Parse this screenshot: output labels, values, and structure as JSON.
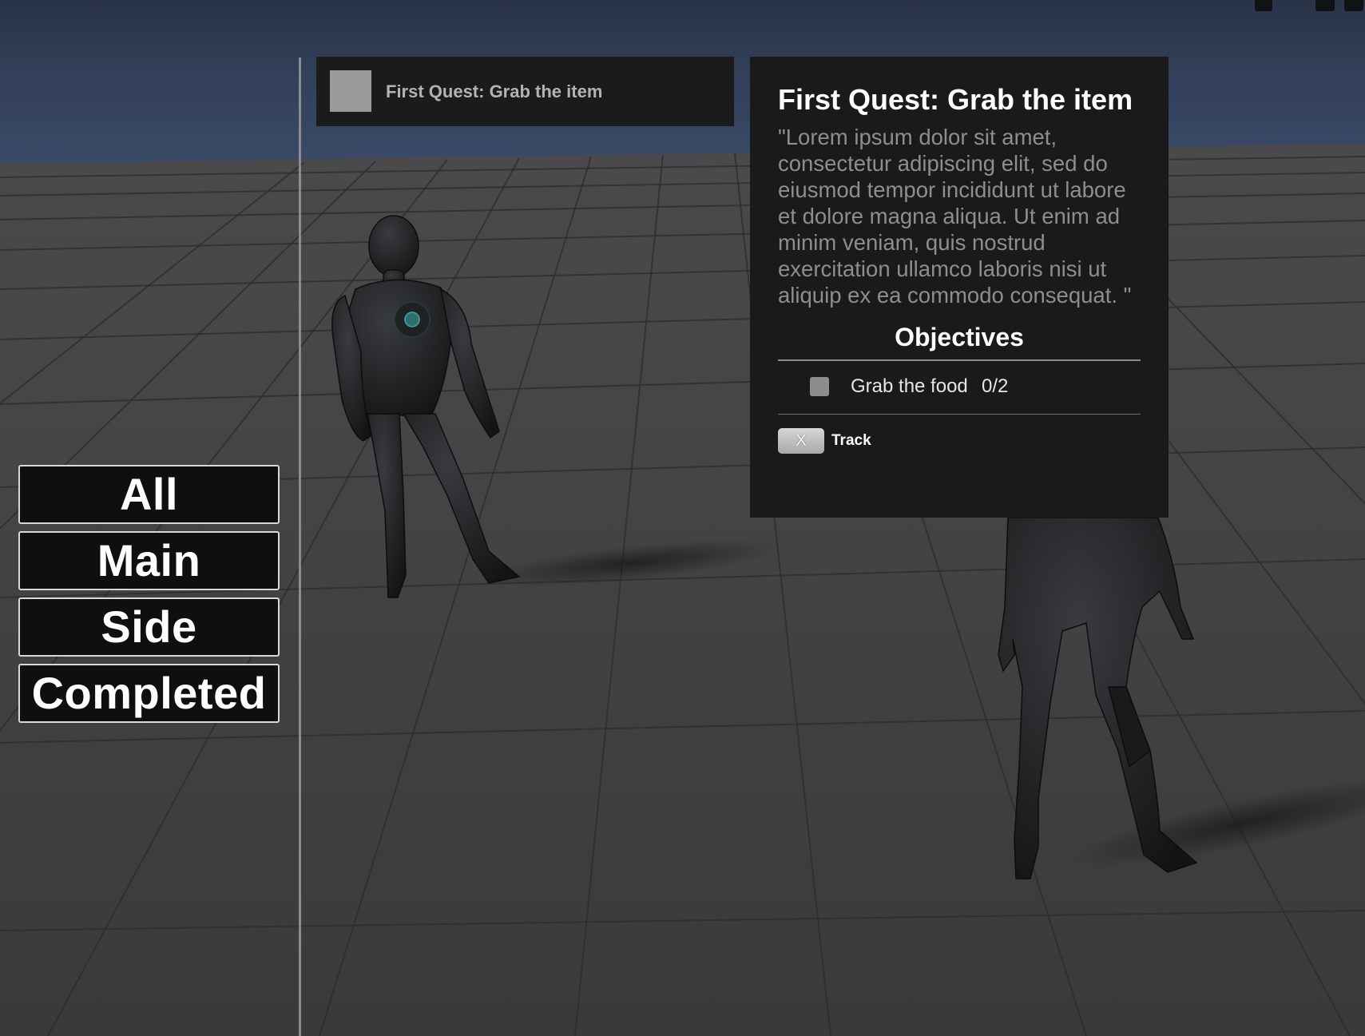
{
  "filters": {
    "all": "All",
    "main": "Main",
    "side": "Side",
    "completed": "Completed"
  },
  "quest_list": {
    "items": [
      {
        "title": "First Quest: Grab the item"
      }
    ]
  },
  "details": {
    "title": "First Quest: Grab the item",
    "description": "\"Lorem ipsum dolor sit amet, consectetur adipiscing elit, sed do eiusmod tempor incididunt ut labore et dolore magna aliqua. Ut enim ad minim veniam, quis nostrud exercitation ullamco laboris nisi ut aliquip ex ea commodo consequat. \"",
    "objectives_heading": "Objectives",
    "objectives": [
      {
        "label": "Grab the food",
        "progress": "0/2",
        "completed": false
      }
    ],
    "track_key": "X",
    "track_label": "Track"
  },
  "colors": {
    "panel_bg": "#1a1a1b",
    "button_bg": "#0f0f10",
    "button_border": "#d8d8d8",
    "description_text": "#8e8e8e",
    "sky": "#33405a",
    "floor": "#3d3c3e"
  }
}
